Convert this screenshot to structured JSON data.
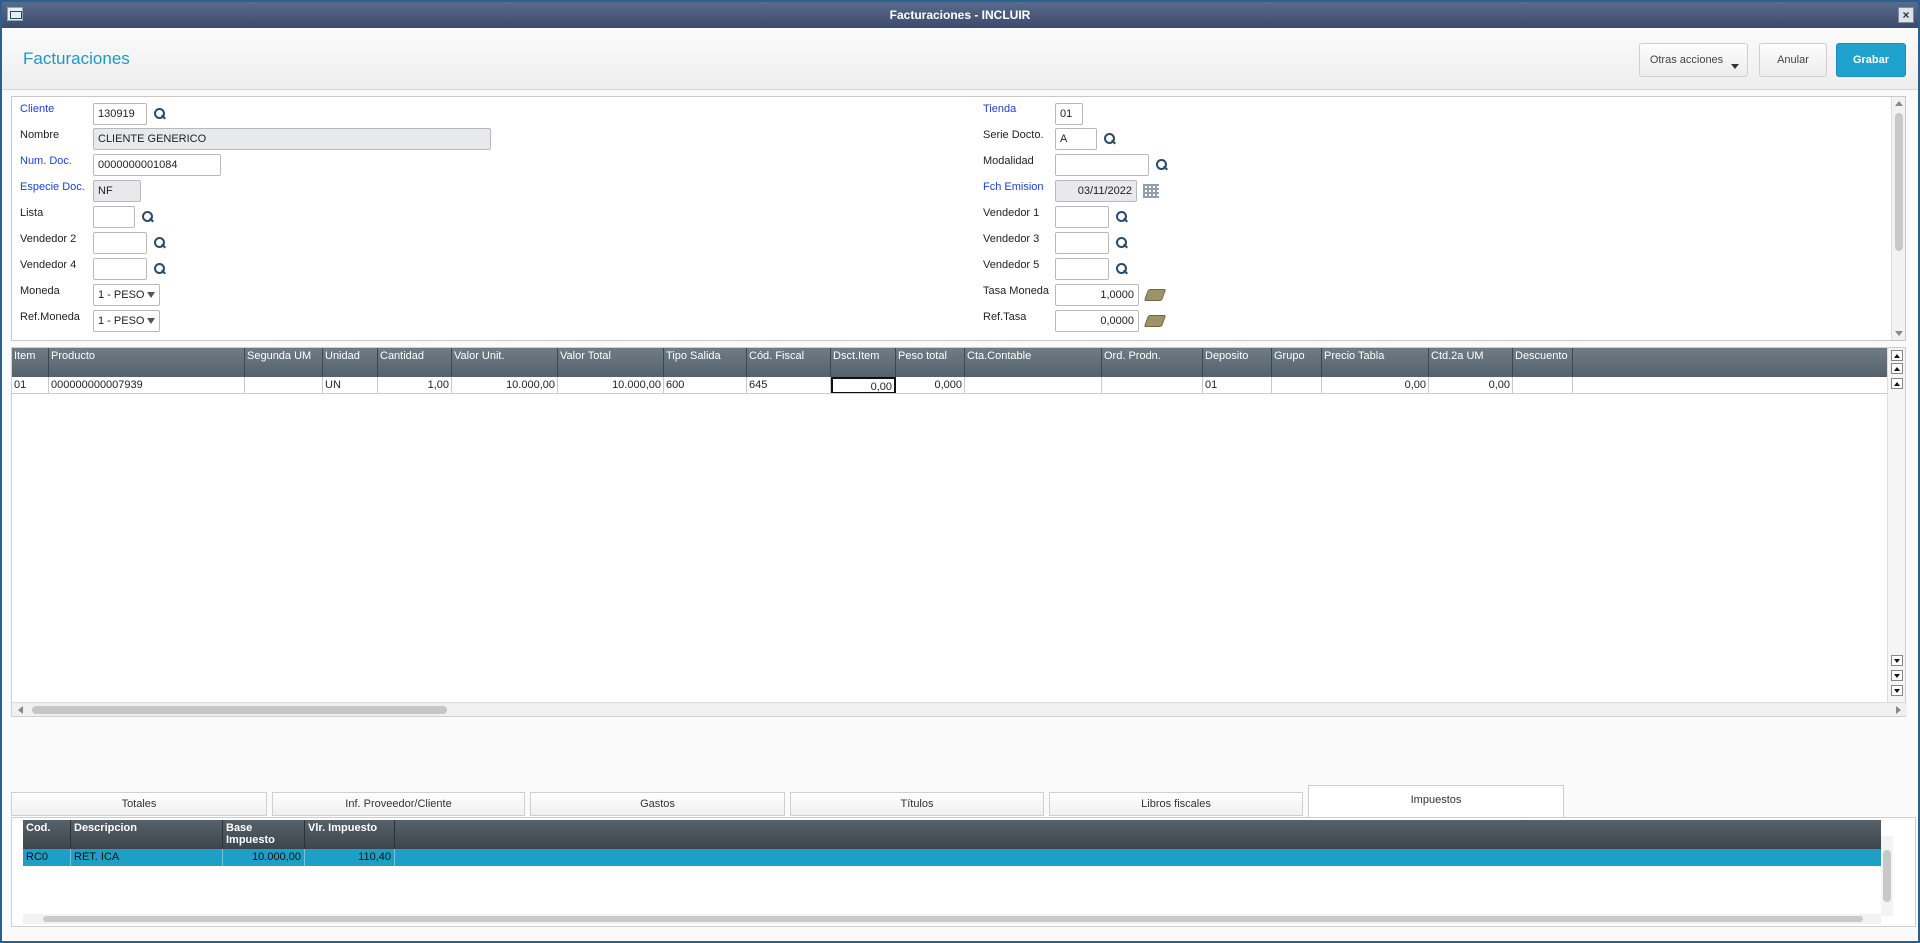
{
  "window": {
    "title": "Facturaciones - INCLUIR",
    "close_glyph": "×"
  },
  "header": {
    "title": "Facturaciones",
    "buttons": {
      "otras": "Otras acciones",
      "anular": "Anular",
      "grabar": "Grabar"
    }
  },
  "form": {
    "cliente": {
      "label": "Cliente",
      "value": "130919"
    },
    "nombre": {
      "label": "Nombre",
      "value": "CLIENTE GENERICO"
    },
    "num_doc": {
      "label": "Num. Doc.",
      "value": "0000000001084"
    },
    "especie_doc": {
      "label": "Especie Doc.",
      "value": "NF"
    },
    "lista": {
      "label": "Lista",
      "value": ""
    },
    "vendedor2": {
      "label": "Vendedor 2",
      "value": ""
    },
    "vendedor4": {
      "label": "Vendedor 4",
      "value": ""
    },
    "moneda": {
      "label": "Moneda",
      "value": "1 - PESO"
    },
    "ref_moneda": {
      "label": "Ref.Moneda",
      "value": "1 - PESO"
    },
    "tienda": {
      "label": "Tienda",
      "value": "01"
    },
    "serie_docto": {
      "label": "Serie Docto.",
      "value": "A"
    },
    "modalidad": {
      "label": "Modalidad",
      "value": ""
    },
    "fch_emision": {
      "label": "Fch Emision",
      "value": "03/11/2022"
    },
    "vendedor1": {
      "label": "Vendedor 1",
      "value": ""
    },
    "vendedor3": {
      "label": "Vendedor 3",
      "value": ""
    },
    "vendedor5": {
      "label": "Vendedor 5",
      "value": ""
    },
    "tasa_moneda": {
      "label": "Tasa Moneda",
      "value": "1,0000"
    },
    "ref_tasa": {
      "label": "Ref.Tasa",
      "value": "0,0000"
    }
  },
  "items_grid": {
    "columns": [
      "Item",
      "Producto",
      "Segunda UM",
      "Unidad",
      "Cantidad",
      "Valor Unit.",
      "Valor Total",
      "Tipo Salida",
      "Cód. Fiscal",
      "Dsct.Item",
      "Peso total",
      "Cta.Contable",
      "Ord. Prodn.",
      "Deposito",
      "Grupo",
      "Precio Tabla",
      "Ctd.2a UM",
      "Descuento"
    ],
    "rows": [
      [
        "01",
        "000000000007939",
        "",
        "UN",
        "1,00",
        "10.000,00",
        "10.000,00",
        "600",
        "645",
        "0,00",
        "0,000",
        "",
        "",
        "01",
        "",
        "0,00",
        "0,00",
        ""
      ]
    ]
  },
  "tabs": [
    "Totales",
    "Inf. Proveedor/Cliente",
    "Gastos",
    "Títulos",
    "Libros fiscales",
    "Impuestos"
  ],
  "active_tab": "Impuestos",
  "taxes_grid": {
    "columns": [
      "Cod.",
      "Descripcion",
      "Base Impuesto",
      "Vlr. Impuesto"
    ],
    "rows": [
      [
        "RC0",
        "RET. ICA",
        "10.000,00",
        "110,40"
      ]
    ]
  },
  "colors": {
    "accent": "#1fa3ce",
    "required_label": "#1b3fd6",
    "selected_row": "#1da0c5"
  }
}
